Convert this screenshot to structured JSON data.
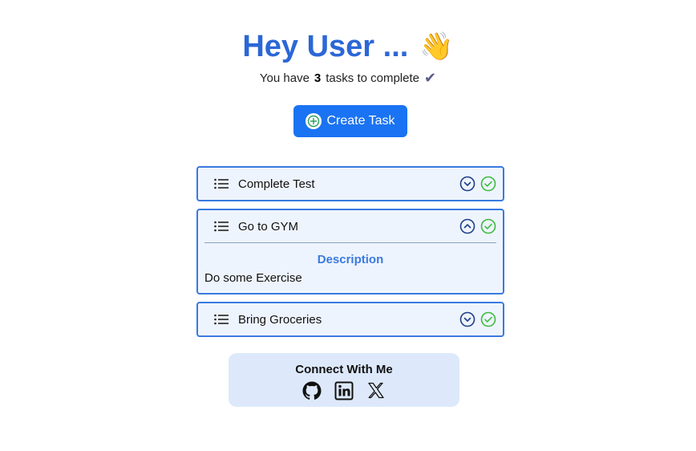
{
  "header": {
    "title": "Hey User ...",
    "wave_emoji": "👋",
    "subtitle_prefix": "You have",
    "task_count": "3",
    "subtitle_suffix": "tasks to complete",
    "check_glyph": "✔"
  },
  "create_button": {
    "label": "Create Task",
    "icon": "plus-circle-icon"
  },
  "tasks": [
    {
      "name": "Complete Test",
      "expanded": false
    },
    {
      "name": "Go to GYM",
      "expanded": true,
      "description_title": "Description",
      "description": "Do some Exercise"
    },
    {
      "name": "Bring Groceries",
      "expanded": false
    }
  ],
  "connect": {
    "title": "Connect With Me",
    "links": [
      "github-icon",
      "linkedin-icon",
      "x-icon"
    ]
  },
  "colors": {
    "accent": "#2b67d6",
    "button": "#1a73f2",
    "task_border": "#3a7ae0",
    "task_bg": "#eef4fd",
    "check_green": "#3dbb3d",
    "connect_bg": "#dde9fb"
  }
}
